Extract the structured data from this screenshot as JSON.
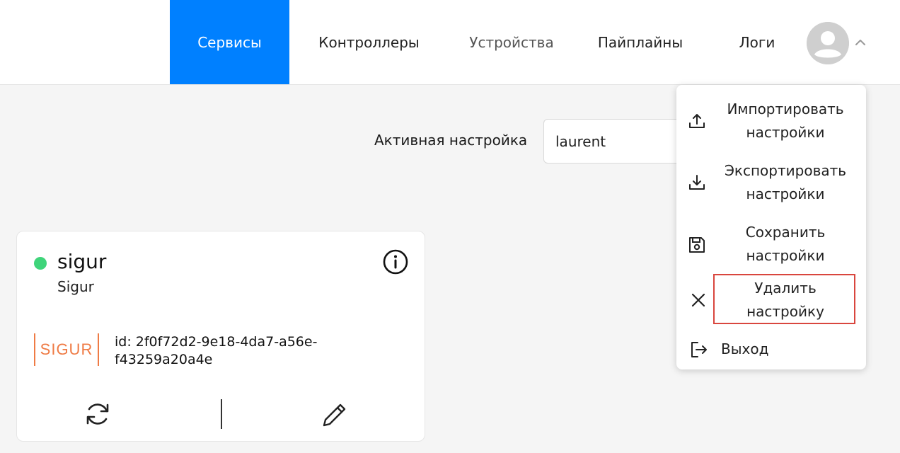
{
  "nav": {
    "items": [
      {
        "label": "Сервисы",
        "active": true
      },
      {
        "label": "Контроллеры"
      },
      {
        "label": "Устройства"
      },
      {
        "label": "Пайплайны"
      },
      {
        "label": "Логи"
      }
    ]
  },
  "active_setting": {
    "label": "Активная настройка",
    "value": "laurent"
  },
  "card": {
    "status_color": "#3fd47a",
    "title": "sigur",
    "subtitle": "Sigur",
    "logo_text": "SIGUR",
    "id_text": "id: 2f0f72d2-9e18-4da7-a56e-f43259a20a4e"
  },
  "user_menu": {
    "items": [
      {
        "line1": "Импортировать",
        "line2": "настройки",
        "icon": "upload-icon"
      },
      {
        "line1": "Экспортировать",
        "line2": "настройки",
        "icon": "download-icon"
      },
      {
        "line1": "Сохранить",
        "line2": "настройки",
        "icon": "save-icon"
      },
      {
        "line1": "Удалить",
        "line2": "настройку",
        "icon": "close-icon"
      },
      {
        "line1": "Выход",
        "icon": "logout-icon"
      }
    ]
  },
  "colors": {
    "accent": "#0080ff",
    "highlight": "#d9463e",
    "brand_logo": "#ef7b45"
  }
}
